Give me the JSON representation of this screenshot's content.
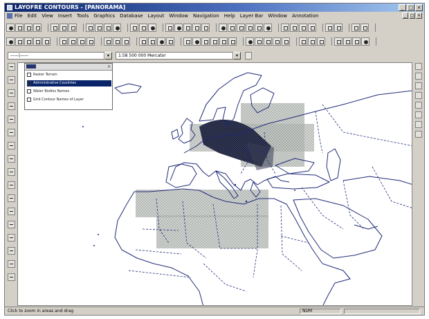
{
  "window": {
    "title": "LAYOFRE CONTOURS - [PANORAMA]",
    "controls": [
      "_",
      "□",
      "×"
    ]
  },
  "menu": [
    "File",
    "Edit",
    "View",
    "Insert",
    "Tools",
    "Graphics",
    "Database",
    "Layout",
    "Window",
    "Navigation",
    "Help",
    "Layer Bar",
    "Window",
    "Annotation"
  ],
  "toolbar": {
    "layer_combo_value": "——|——",
    "scale_combo_value": "1:58 500 000 Mercator"
  },
  "legend": {
    "items": [
      {
        "label": "Raster Terrain",
        "checked": true,
        "selected": false
      },
      {
        "label": "Administrative Countries",
        "checked": true,
        "selected": true
      },
      {
        "label": "Water Bodies Names",
        "checked": true,
        "selected": false
      },
      {
        "label": "Grid Contour Names of Layer",
        "checked": true,
        "selected": false
      }
    ]
  },
  "status": {
    "left": "Click to zoom in areas and drag",
    "middle": "NUM"
  },
  "colors": {
    "coastline": "#1f2a78",
    "grid_fill": "#a6aaa6",
    "title_bar": "#0a246a",
    "toolbar_bg": "#d4d0c8"
  }
}
